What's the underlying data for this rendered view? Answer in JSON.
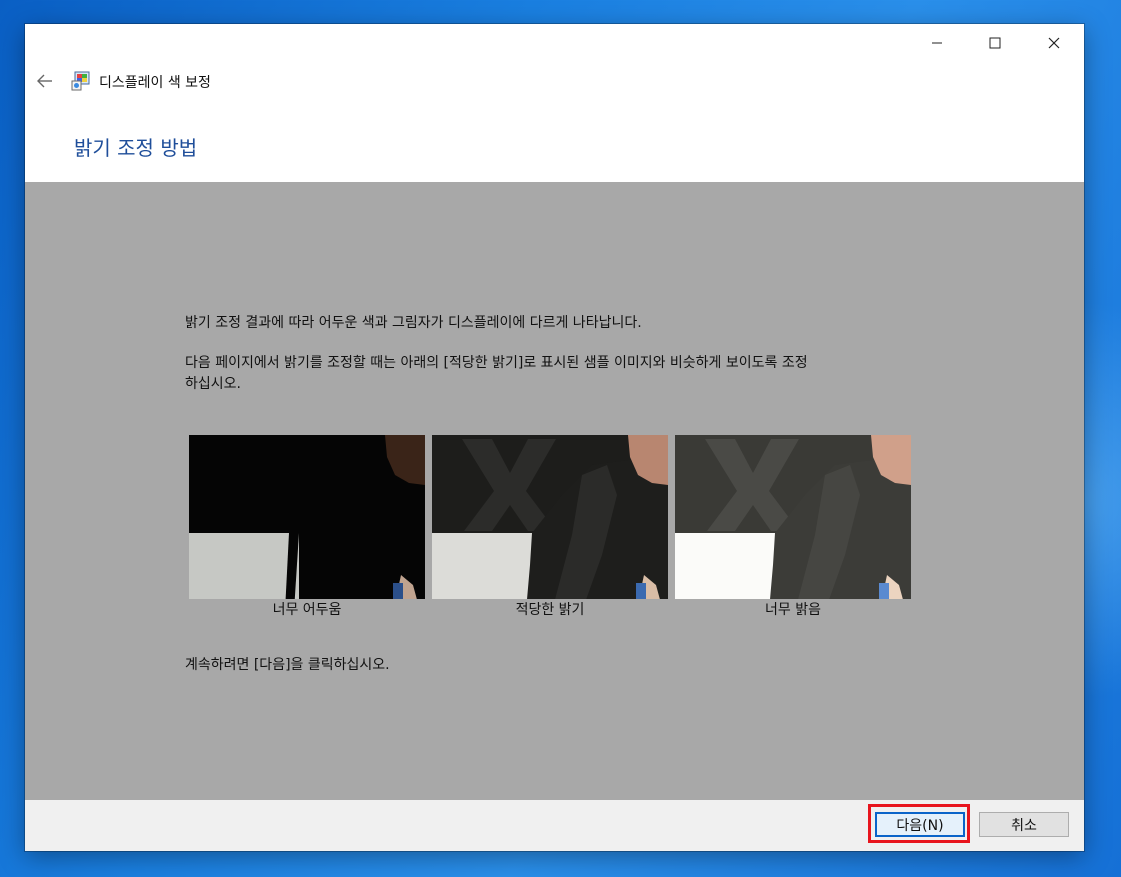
{
  "window": {
    "title": "디스플레이 색 보정",
    "heading": "밝기 조정 방법"
  },
  "content": {
    "line1": "밝기 조정 결과에 따라 어두운 색과 그림자가 디스플레이에 다르게 나타납니다.",
    "line2a": "다음 페이지에서 밝기를 조정할 때는 아래의 [적당한 밝기]로 표시된 샘플 이미지와 비슷하게 보이도록 조정",
    "line2b": "하십시오.",
    "continue_hint": "계속하려면 [다음]을 클릭하십시오."
  },
  "samples": [
    {
      "caption": "너무 어두움"
    },
    {
      "caption": "적당한 밝기"
    },
    {
      "caption": "너무 밝음"
    }
  ],
  "buttons": {
    "next_label": "다음(N)",
    "cancel_label": "취소"
  },
  "colors": {
    "heading": "#1f4e9a",
    "content_bg": "#a8a8a8",
    "highlight": "#e8141d",
    "focus_border": "#0a64c9"
  }
}
